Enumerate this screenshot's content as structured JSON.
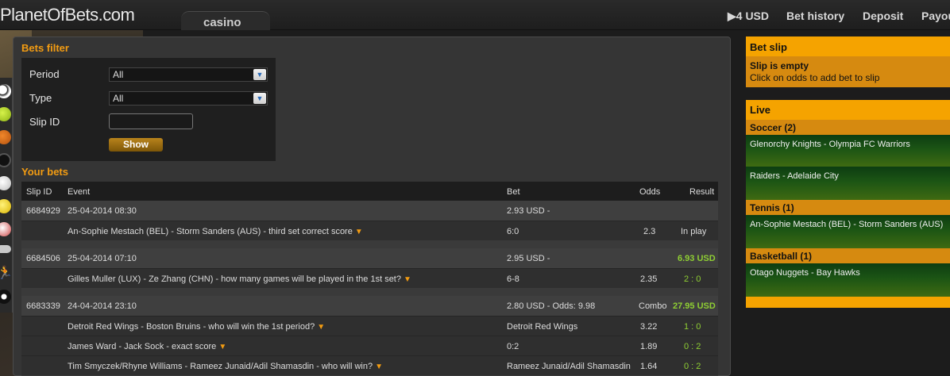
{
  "header": {
    "logo": "PlanetOfBets.com",
    "tab_casino": "casino",
    "balance": "▶4 USD",
    "nav": [
      "Bet history",
      "Deposit",
      "Payou"
    ]
  },
  "sports_icons": [
    "soccer-icon",
    "tennis-icon",
    "basketball-icon",
    "hockey-icon",
    "baseball-icon",
    "volleyball-icon",
    "rugby-icon",
    "football-icon",
    "running-icon",
    "snooker-icon"
  ],
  "filter": {
    "title": "Bets filter",
    "period_label": "Period",
    "period_value": "All",
    "type_label": "Type",
    "type_value": "All",
    "slip_label": "Slip ID",
    "slip_value": "",
    "show_button": "Show"
  },
  "bets": {
    "title": "Your bets",
    "columns": [
      "Slip ID",
      "Event",
      "Bet",
      "Odds",
      "Result"
    ],
    "slips": [
      {
        "slip_id": "6684929",
        "date": "25-04-2014 08:30",
        "bet": "2.93 USD -",
        "odds": "",
        "result": "",
        "events": [
          {
            "event": "An-Sophie Mestach (BEL) - Storm Sanders (AUS) - third set correct score",
            "bet": "6:0",
            "odds": "2.3",
            "result": "In play"
          }
        ]
      },
      {
        "slip_id": "6684506",
        "date": "25-04-2014 07:10",
        "bet": "2.95 USD -",
        "odds": "",
        "result": "6.93 USD",
        "events": [
          {
            "event": "Gilles Muller (LUX) - Ze Zhang (CHN) - how many games will be played in the 1st set?",
            "bet": "6-8",
            "odds": "2.35",
            "result": "2 : 0"
          }
        ]
      },
      {
        "slip_id": "6683339",
        "date": "24-04-2014 23:10",
        "bet": "2.80 USD - Odds: 9.98",
        "odds": "Combo",
        "result": "27.95 USD",
        "events": [
          {
            "event": "Detroit Red Wings - Boston Bruins - who will win the 1st period?",
            "bet": "Detroit Red Wings",
            "odds": "3.22",
            "result": "1 : 0"
          },
          {
            "event": "James Ward - Jack Sock - exact score",
            "bet": "0:2",
            "odds": "1.89",
            "result": "0 : 2"
          },
          {
            "event": "Tim Smyczek/Rhyne Williams - Rameez Junaid/Adil Shamasdin - who will win?",
            "bet": "Rameez Junaid/Adil Shamasdin",
            "odds": "1.64",
            "result": "0 : 2"
          }
        ]
      }
    ]
  },
  "betslip": {
    "title": "Bet slip",
    "empty": "Slip is empty",
    "hint": "Click on odds to add bet to slip"
  },
  "live": {
    "title": "Live",
    "categories": [
      {
        "name": "Soccer (2)",
        "matches": [
          "Glenorchy Knights - Olympia FC Warriors",
          "Raiders - Adelaide City"
        ]
      },
      {
        "name": "Tennis (1)",
        "matches": [
          "An-Sophie Mestach (BEL) - Storm Sanders (AUS)"
        ]
      },
      {
        "name": "Basketball (1)",
        "matches": [
          "Otago Nuggets - Bay Hawks"
        ]
      }
    ]
  },
  "colors": {
    "accent": "#f5a300",
    "accent_dark": "#d68a10",
    "result_green": "#8fcf33",
    "live_green": "#1c5514"
  }
}
